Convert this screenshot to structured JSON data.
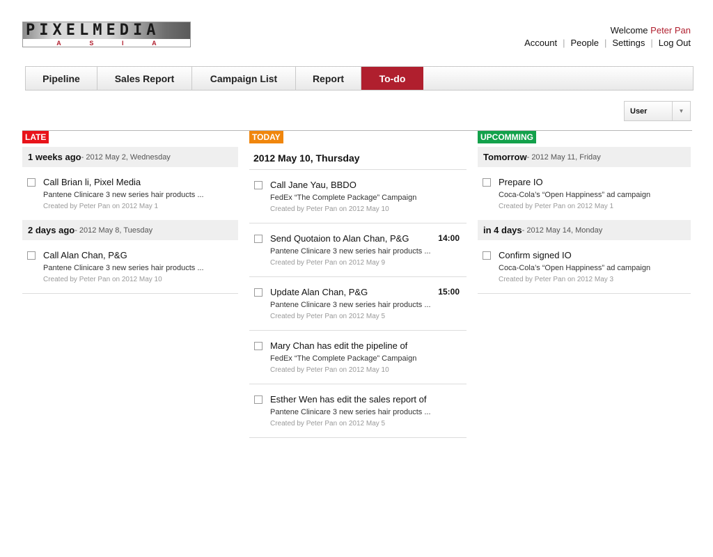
{
  "header": {
    "logo_top": [
      "P",
      "I",
      "X",
      "E",
      "L",
      "M",
      "E",
      "D",
      "I",
      "A"
    ],
    "logo_bottom": [
      "A",
      "S",
      "I",
      "A"
    ],
    "welcome_text": "Welcome",
    "user_name": "Peter Pan",
    "links": [
      "Account",
      "People",
      "Settings",
      "Log Out"
    ]
  },
  "tabs": [
    {
      "label": "Pipeline",
      "active": false
    },
    {
      "label": "Sales Report",
      "active": false
    },
    {
      "label": "Campaign List",
      "active": false
    },
    {
      "label": "Report",
      "active": false
    },
    {
      "label": "To-do",
      "active": true
    }
  ],
  "filter": {
    "selected": "User"
  },
  "late": {
    "badge": "LATE",
    "groups": [
      {
        "title": "1 weeks ago",
        "subtitle": " - 2012 May 2, Wednesday",
        "tasks": [
          {
            "title": "Call Brian li, Pixel Media",
            "desc": "Pantene Clinicare 3 new series hair products ...",
            "meta": "Created by Peter Pan on 2012 May 1"
          }
        ]
      },
      {
        "title": "2 days ago",
        "subtitle": " - 2012 May 8, Tuesday",
        "tasks": [
          {
            "title": "Call Alan Chan, P&G",
            "desc": "Pantene Clinicare 3 new series hair products ...",
            "meta": "Created by Peter Pan on 2012 May 10"
          }
        ]
      }
    ]
  },
  "today": {
    "badge": "TODAY",
    "heading": "2012 May 10, Thursday",
    "tasks": [
      {
        "title": "Call Jane Yau, BBDO",
        "desc": "FedEx “The Complete Package” Campaign",
        "meta": "Created by Peter Pan on 2012 May 10",
        "time": ""
      },
      {
        "title": "Send Quotaion to Alan Chan, P&G",
        "desc": "Pantene Clinicare 3 new series hair products ...",
        "meta": "Created by Peter Pan on 2012 May 9",
        "time": "14:00"
      },
      {
        "title": "Update Alan Chan, P&G",
        "desc": "Pantene Clinicare 3 new series hair products ...",
        "meta": "Created by Peter Pan on 2012 May 5",
        "time": "15:00"
      },
      {
        "title": "Mary Chan has edit the pipeline of",
        "desc": "FedEx “The Complete Package” Campaign",
        "meta": "Created by Peter Pan on 2012 May 10",
        "time": ""
      },
      {
        "title": "Esther Wen has edit the sales report of",
        "desc": "Pantene Clinicare 3 new series hair products ...",
        "meta": "Created by Peter Pan on 2012 May 5",
        "time": ""
      }
    ]
  },
  "upcoming": {
    "badge": "UPCOMMING",
    "groups": [
      {
        "title": "Tomorrow",
        "subtitle": " - 2012 May 11, Friday",
        "tasks": [
          {
            "title": "Prepare IO",
            "desc": "Coca-Cola’s “Open Happiness” ad campaign",
            "meta": "Created by Peter Pan on 2012 May 1"
          }
        ]
      },
      {
        "title": "in 4 days",
        "subtitle": " - 2012 May 14, Monday",
        "tasks": [
          {
            "title": "Confirm signed IO",
            "desc": "Coca-Cola’s “Open Happiness” ad campaign",
            "meta": "Created by Peter Pan on 2012 May 3"
          }
        ]
      }
    ]
  }
}
